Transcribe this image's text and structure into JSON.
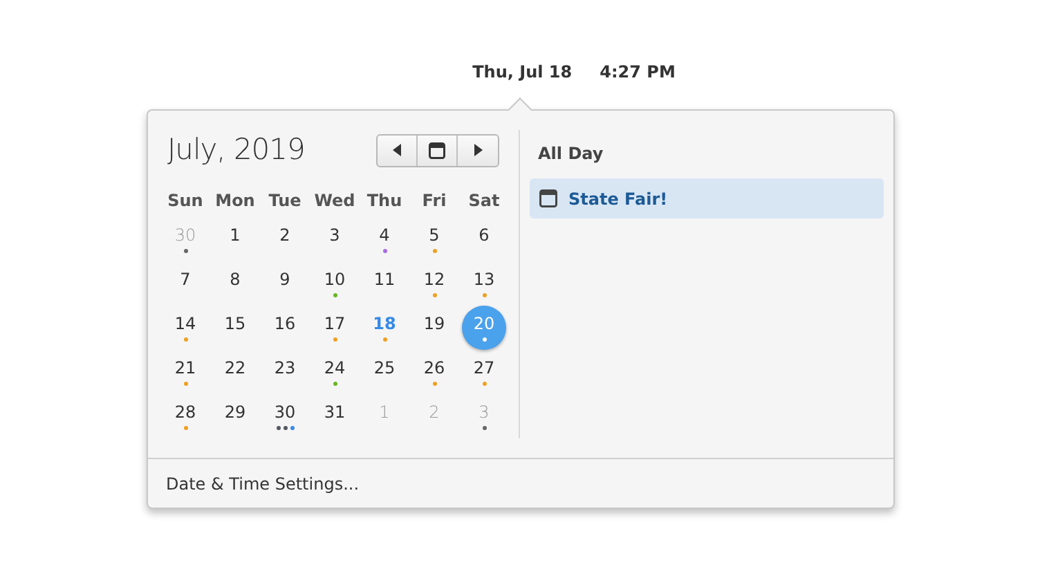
{
  "top_bar": {
    "date": "Thu, Jul 18",
    "time": "4:27 PM"
  },
  "calendar": {
    "month_title": "July, 2019",
    "weekdays": [
      "Sun",
      "Mon",
      "Tue",
      "Wed",
      "Thu",
      "Fri",
      "Sat"
    ],
    "weeks": [
      [
        {
          "label": "30",
          "outside": true,
          "selected": false,
          "dots": [
            {
              "color": "#666666"
            }
          ]
        },
        {
          "label": "1",
          "selected": false
        },
        {
          "label": "2",
          "selected": false
        },
        {
          "label": "3",
          "selected": false
        },
        {
          "label": "4",
          "selected": false,
          "dots": [
            {
              "color": "#a56de2"
            }
          ]
        },
        {
          "label": "5",
          "selected": false,
          "dots": [
            {
              "color": "#f0a020"
            }
          ]
        },
        {
          "label": "6",
          "selected": false
        }
      ],
      [
        {
          "label": "7",
          "selected": false
        },
        {
          "label": "8",
          "selected": false
        },
        {
          "label": "9",
          "selected": false
        },
        {
          "label": "10",
          "selected": false,
          "dots": [
            {
              "color": "#68b723"
            }
          ]
        },
        {
          "label": "11",
          "selected": false
        },
        {
          "label": "12",
          "selected": false,
          "dots": [
            {
              "color": "#f0a020"
            }
          ]
        },
        {
          "label": "13",
          "selected": false,
          "dots": [
            {
              "color": "#f0a020"
            }
          ]
        }
      ],
      [
        {
          "label": "14",
          "selected": false,
          "dots": [
            {
              "color": "#f0a020"
            }
          ]
        },
        {
          "label": "15",
          "selected": false
        },
        {
          "label": "16",
          "selected": false
        },
        {
          "label": "17",
          "selected": false,
          "dots": [
            {
              "color": "#f0a020"
            }
          ]
        },
        {
          "label": "18",
          "today": true,
          "selected": false,
          "dots": [
            {
              "color": "#f0a020"
            }
          ]
        },
        {
          "label": "19",
          "selected": false
        },
        {
          "label": "20",
          "selected": true,
          "dots": [
            {
              "color": "#ffffff"
            }
          ]
        }
      ],
      [
        {
          "label": "21",
          "selected": false,
          "dots": [
            {
              "color": "#f0a020"
            }
          ]
        },
        {
          "label": "22",
          "selected": false
        },
        {
          "label": "23",
          "selected": false
        },
        {
          "label": "24",
          "selected": false,
          "dots": [
            {
              "color": "#68b723"
            }
          ]
        },
        {
          "label": "25",
          "selected": false
        },
        {
          "label": "26",
          "selected": false,
          "dots": [
            {
              "color": "#f0a020"
            }
          ]
        },
        {
          "label": "27",
          "selected": false,
          "dots": [
            {
              "color": "#f0a020"
            }
          ]
        }
      ],
      [
        {
          "label": "28",
          "selected": false,
          "dots": [
            {
              "color": "#f0a020"
            }
          ]
        },
        {
          "label": "29",
          "selected": false
        },
        {
          "label": "30",
          "selected": false,
          "dots": [
            {
              "color": "#555761"
            },
            {
              "color": "#555761"
            },
            {
              "color": "#3689e6"
            }
          ]
        },
        {
          "label": "31",
          "selected": false
        },
        {
          "label": "1",
          "outside": true,
          "selected": false
        },
        {
          "label": "2",
          "outside": true,
          "selected": false
        },
        {
          "label": "3",
          "outside": true,
          "selected": false,
          "dots": [
            {
              "color": "#666666"
            }
          ]
        }
      ]
    ]
  },
  "events": {
    "heading": "All Day",
    "items": [
      {
        "title": "State Fair!",
        "selected": true
      }
    ]
  },
  "footer": {
    "settings_link": "Date & Time Settings..."
  }
}
